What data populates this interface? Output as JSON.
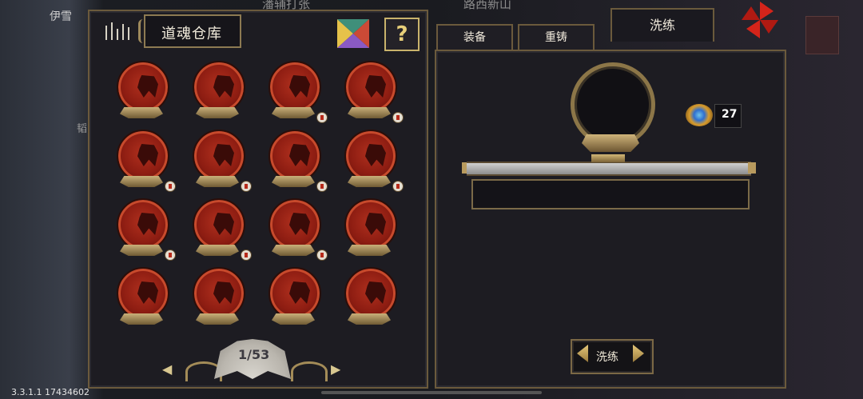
{
  "background": {
    "left_name": "伊雪",
    "left_side_text": "韬",
    "top_text_1": "潘辅打张",
    "top_text_2": "路西新山"
  },
  "warehouse": {
    "title": "道魂仓库",
    "help_label": "?",
    "page_indicator": "1/53",
    "prev_arrow": "◀",
    "next_arrow": "▶",
    "slots": [
      {
        "badge": false
      },
      {
        "badge": false
      },
      {
        "badge": true
      },
      {
        "badge": true
      },
      {
        "badge": true
      },
      {
        "badge": true
      },
      {
        "badge": true
      },
      {
        "badge": true
      },
      {
        "badge": true
      },
      {
        "badge": true
      },
      {
        "badge": true
      },
      {
        "badge": false
      },
      {
        "badge": false
      },
      {
        "badge": false
      },
      {
        "badge": false
      },
      {
        "badge": false
      }
    ]
  },
  "tabs": [
    {
      "label": "装备",
      "active": false
    },
    {
      "label": "重铸",
      "active": false
    },
    {
      "label": "洗练",
      "active": true
    }
  ],
  "refine": {
    "currency_value": "27",
    "progress": 0,
    "action_label": "洗练"
  },
  "footer": {
    "version": "3.3.1.1 17434602"
  },
  "colors": {
    "orb_red": "#b0301e",
    "gold_border": "#8d7a52",
    "panel_bg": "#1d1c22"
  }
}
